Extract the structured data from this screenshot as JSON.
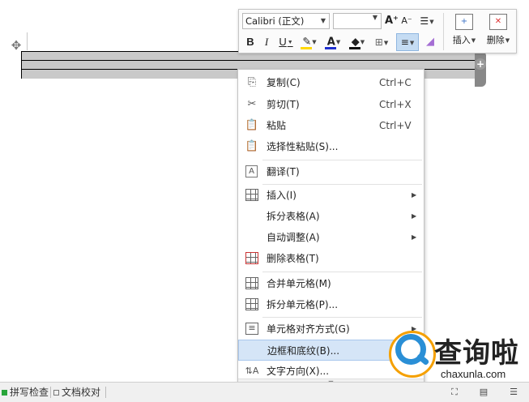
{
  "minibar": {
    "font_name": "Calibri (正文)",
    "font_size": "",
    "grow_glyph": "A⁺",
    "shrink_glyph": "A⁻",
    "bold": "B",
    "italic": "I",
    "underline": "U",
    "font_color_glyph": "A",
    "insert_label": "插入",
    "delete_label": "删除"
  },
  "menu": {
    "items": [
      {
        "label": "复制(C)",
        "shortcut": "Ctrl+C",
        "icon": "copy-icon"
      },
      {
        "label": "剪切(T)",
        "shortcut": "Ctrl+X",
        "icon": "scissors-icon"
      },
      {
        "label": "粘贴",
        "shortcut": "Ctrl+V",
        "icon": "paste-icon"
      },
      {
        "label": "选择性粘贴(S)...",
        "icon": "paste-special-icon"
      },
      {
        "label": "翻译(T)",
        "icon": "translate-icon"
      },
      {
        "label": "插入(I)",
        "icon": "table-insert-icon"
      },
      {
        "label": "拆分表格(A)"
      },
      {
        "label": "自动调整(A)"
      },
      {
        "label": "删除表格(T)",
        "icon": "table-delete-icon"
      },
      {
        "label": "合并单元格(M)",
        "icon": "merge-cells-icon"
      },
      {
        "label": "拆分单元格(P)...",
        "icon": "split-cells-icon"
      },
      {
        "label": "单元格对齐方式(G)",
        "icon": "cell-align-icon"
      },
      {
        "label": "边框和底纹(B)..."
      },
      {
        "label": "文字方向(X)...",
        "icon": "text-direction-icon"
      }
    ]
  },
  "status": {
    "spell_check": "拼写检查",
    "doc_proof": "文档校对"
  },
  "logo": {
    "cn": "查询啦",
    "en": "chaxunla.com"
  },
  "colors": {
    "highlight": "#ffd800",
    "font_color": "#1e2fd0",
    "menu_hover": "#d5e5f7",
    "logo_blue": "#2a8fd6",
    "logo_orange": "#f5a000"
  }
}
